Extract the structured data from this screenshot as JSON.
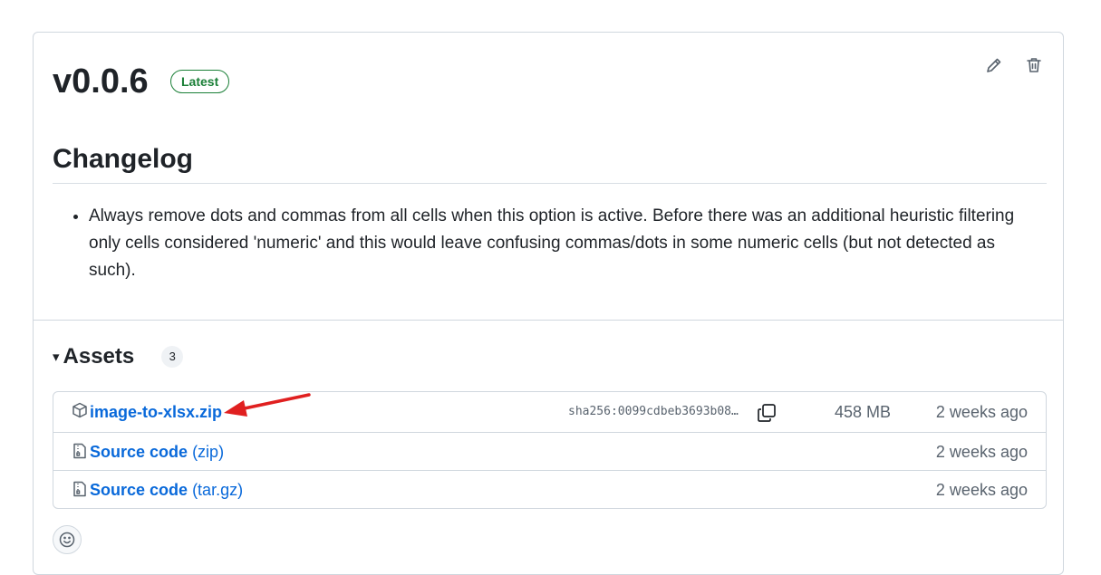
{
  "release": {
    "tag": "v0.0.6",
    "badge": "Latest",
    "actions": [
      {
        "name": "edit",
        "icon": "pencil-icon"
      },
      {
        "name": "delete",
        "icon": "trash-icon"
      }
    ]
  },
  "changelog": {
    "heading": "Changelog",
    "items": [
      "Always remove dots and commas from all cells when this option is active. Before there was an additional heuristic filtering only cells considered 'numeric' and this would leave confusing commas/dots in some numeric cells (but not detected as such)."
    ]
  },
  "assets": {
    "caret": "▾",
    "title": "Assets",
    "count": "3",
    "rows": [
      {
        "icon": "package-icon",
        "name": "image-to-xlsx.zip",
        "format": "",
        "sha": "sha256:0099cdbeb3693b08…",
        "size": "458 MB",
        "date": "2 weeks ago"
      },
      {
        "icon": "file-zip-icon",
        "name": "Source code",
        "format": "(zip)",
        "date": "2 weeks ago"
      },
      {
        "icon": "file-zip-icon",
        "name": "Source code",
        "format": "(tar.gz)",
        "date": "2 weeks ago"
      }
    ]
  },
  "colors": {
    "link": "#0969da",
    "badge_green": "#1a7f37",
    "annotation_arrow": "#e02020"
  }
}
